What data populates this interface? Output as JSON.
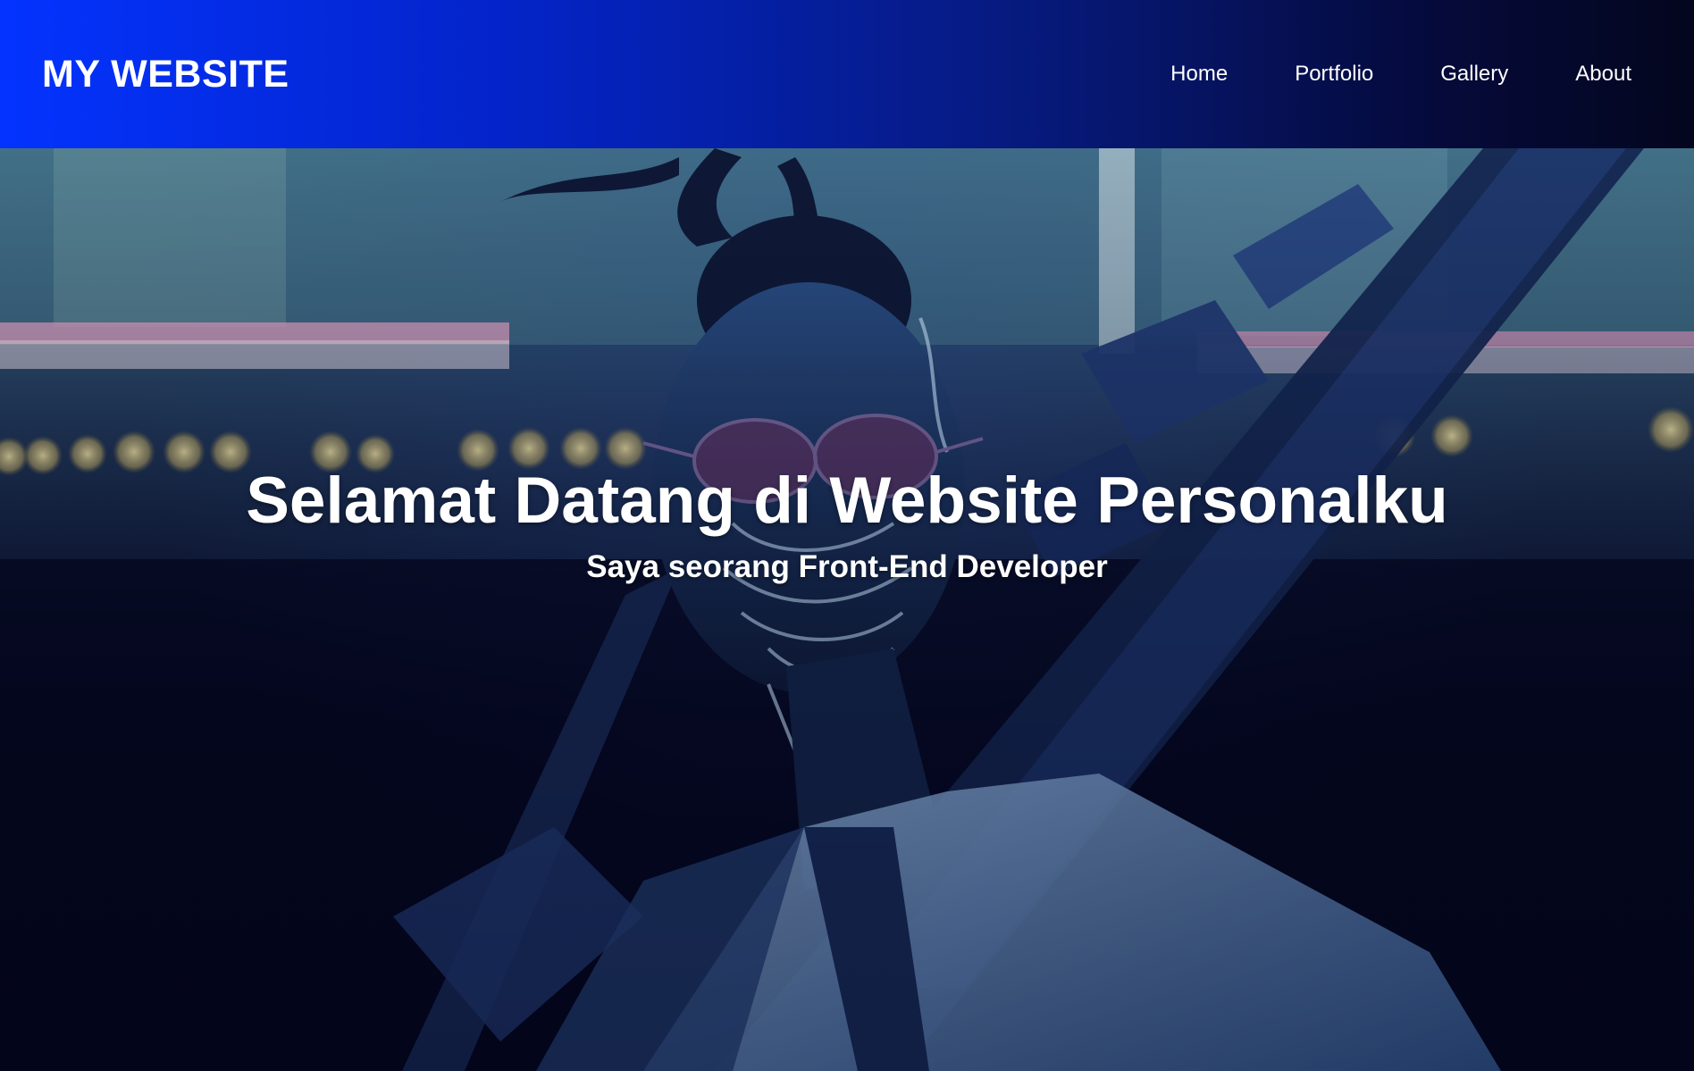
{
  "header": {
    "logo": "MY WEBSITE",
    "nav": [
      {
        "label": "Home"
      },
      {
        "label": "Portfolio"
      },
      {
        "label": "Gallery"
      },
      {
        "label": "About"
      }
    ]
  },
  "hero": {
    "title": "Selamat Datang di Website Personalku",
    "subtitle": "Saya seorang Front-End Developer",
    "image": "hero-background-photo"
  },
  "colors": {
    "header_gradient_start": "#0433ff",
    "header_gradient_end": "#04061e",
    "text": "#ffffff"
  }
}
